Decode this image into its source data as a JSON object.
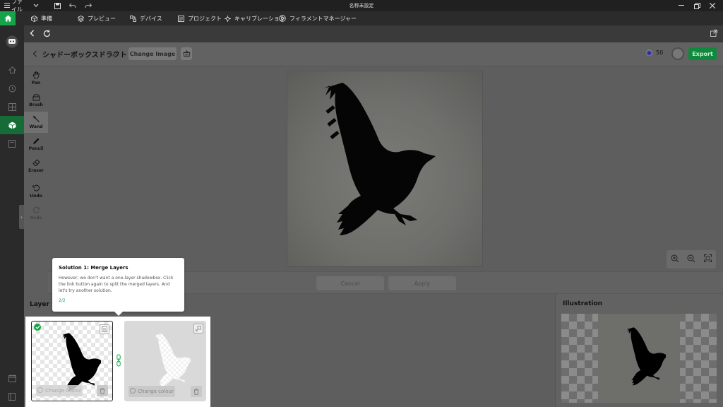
{
  "titlebar": {
    "menu_label": "ファイル",
    "title": "名称未設定"
  },
  "tabs": [
    {
      "label": "準備"
    },
    {
      "label": "プレビュー"
    },
    {
      "label": "デバイス"
    },
    {
      "label": "プロジェクト"
    },
    {
      "label": "キャリブレーション"
    },
    {
      "label": "フィラメントマネージャー"
    }
  ],
  "header": {
    "project_title": "シャドーボックスドラフト",
    "change_image_label": "Change Image",
    "credits": "50",
    "export_label": "Export"
  },
  "tools": [
    {
      "label": "Pan",
      "icon": "hand-icon"
    },
    {
      "label": "Brush",
      "icon": "brush-icon"
    },
    {
      "label": "Wand",
      "icon": "wand-icon"
    },
    {
      "label": "Pencil",
      "icon": "pencil-icon"
    },
    {
      "label": "Eraser",
      "icon": "eraser-icon"
    },
    {
      "label": "Undo",
      "icon": "undo-icon"
    },
    {
      "label": "Redo",
      "icon": "redo-icon"
    }
  ],
  "actions": {
    "cancel_label": "Cancel",
    "apply_label": "Apply"
  },
  "layers": {
    "heading": "Layer (2",
    "change_colour_label": "Change colour"
  },
  "illustration": {
    "heading": "Illustration"
  },
  "tooltip": {
    "title": "Solution 1: Merge Layers",
    "body": "However, we don't want a one-layer shadowbox. Click the link button again to split the merged layers. And let's try another solution.",
    "step": "2/2"
  },
  "colors": {
    "accent": "#16a34a",
    "export": "#0f8a3c"
  }
}
